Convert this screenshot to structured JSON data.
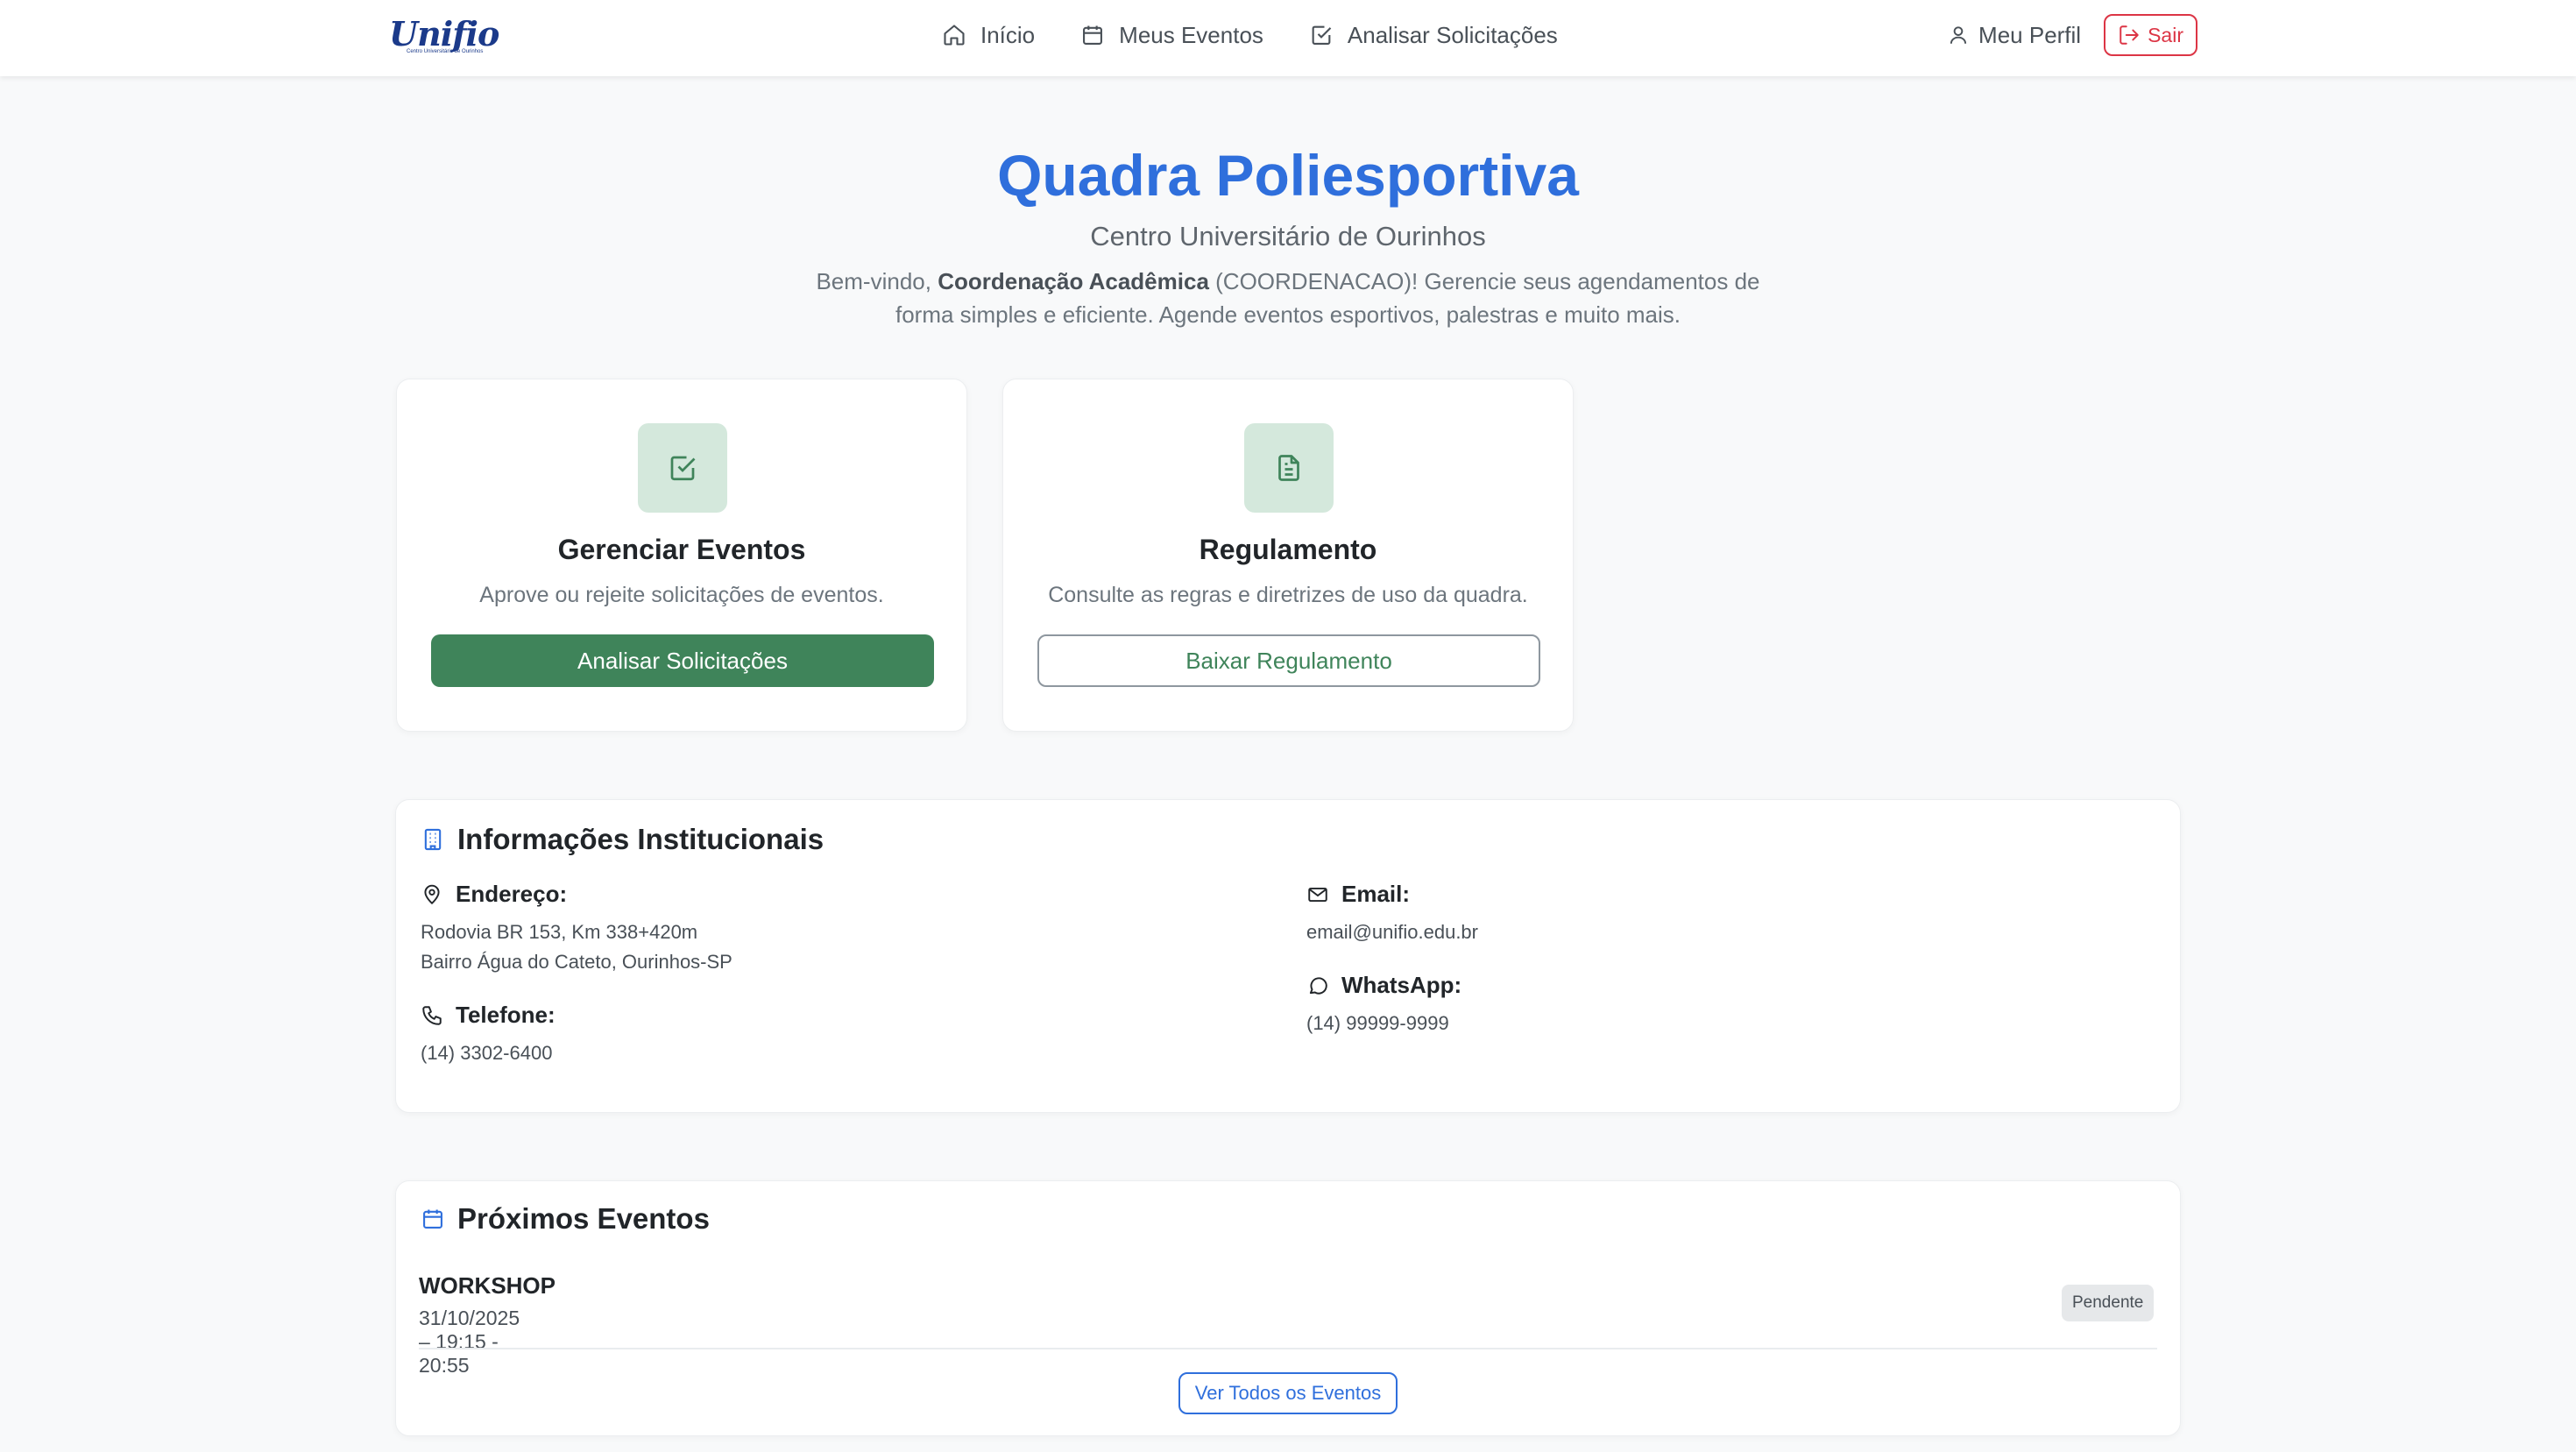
{
  "nav": {
    "logo_text": "Unifio",
    "logo_subtitle": "Centro Universitário de Ourinhos",
    "links": [
      {
        "label": "Início",
        "icon": "home-icon"
      },
      {
        "label": "Meus Eventos",
        "icon": "calendar-icon"
      },
      {
        "label": "Analisar Solicitações",
        "icon": "check-square-icon"
      }
    ],
    "profile_label": "Meu Perfil",
    "logout_label": "Sair"
  },
  "hero": {
    "title": "Quadra Poliesportiva",
    "subtitle": "Centro Universitário de Ourinhos",
    "welcome_prefix": "Bem-vindo, ",
    "user_name": "Coordenação Acadêmica",
    "welcome_suffix": " (COORDENACAO)! Gerencie seus agendamentos de forma simples e eficiente. Agende eventos esportivos, palestras e muito mais."
  },
  "cards": [
    {
      "icon": "check-square-icon",
      "title": "Gerenciar Eventos",
      "description": "Aprove ou rejeite solicitações de eventos.",
      "button_label": "Analisar Solicitações"
    },
    {
      "icon": "document-icon",
      "title": "Regulamento",
      "description": "Consulte as regras e diretrizes de uso da quadra.",
      "button_label": "Baixar Regulamento"
    }
  ],
  "info": {
    "title": "Informações Institucionais",
    "address_label": "Endereço:",
    "address_line1": "Rodovia BR 153, Km 338+420m",
    "address_line2": "Bairro Água do Cateto, Ourinhos-SP",
    "phone_label": "Telefone:",
    "phone_value": "(14) 3302-6400",
    "email_label": "Email:",
    "email_value": "email@unifio.edu.br",
    "whatsapp_label": "WhatsApp:",
    "whatsapp_value": "(14) 99999-9999"
  },
  "events": {
    "title": "Próximos Eventos",
    "items": [
      {
        "name": "WORKSHOP",
        "datetime": "31/10/2025 – 19:15 - 20:55",
        "status": "Pendente"
      }
    ],
    "see_all_label": "Ver Todos os Eventos"
  },
  "colors": {
    "primary_blue": "#2f6fdc",
    "green": "#3f845a",
    "danger": "#dc3545",
    "logo_blue": "#1b3a8a"
  }
}
